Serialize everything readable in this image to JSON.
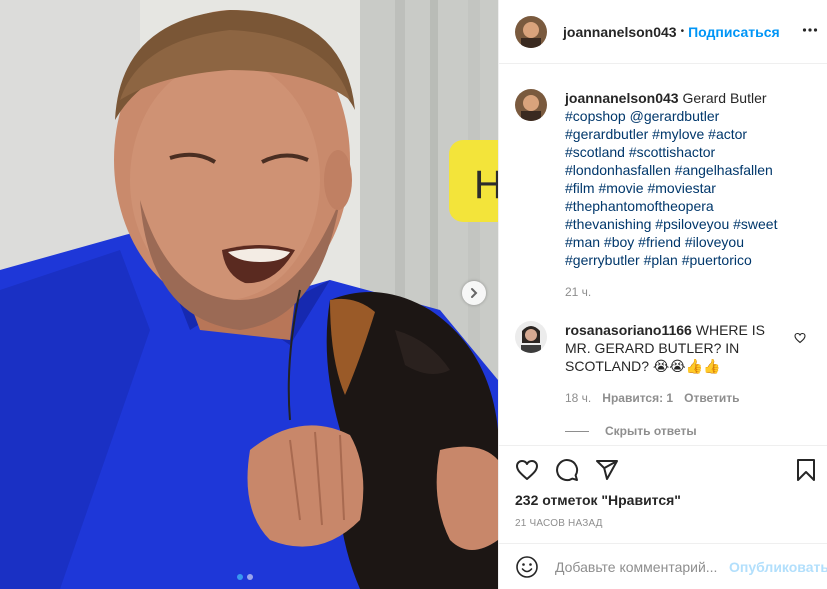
{
  "post": {
    "author": "joannanelson043",
    "header_separator": "•",
    "follow_label": "Подписаться",
    "more_icon": "more-horizontal-icon"
  },
  "media": {
    "next_icon": "chevron-right-icon",
    "slide_index": 1,
    "slide_count": 2,
    "sign_letter": "H"
  },
  "caption": {
    "username": "joannanelson043",
    "text": "Gerard Butler",
    "hashtags": "#copshop @gerardbutler #gerardbutler #mylove #actor #scotland #scottishactor #londonhasfallen #angelhasfallen #film #movie #moviestar #thephantomoftheopera #thevanishing #psiloveyou #sweet #man #boy #friend #iloveyou #gerrybutler #plan #puertorico",
    "time": "21 ч."
  },
  "comment": {
    "username": "rosanasoriano1166",
    "text": "WHERE IS MR. GERARD BUTLER? IN SCOTLAND? 😭😭👍👍",
    "time": "18 ч.",
    "likes": "Нравится: 1",
    "reply": "Ответить",
    "like_icon": "heart-outline-icon"
  },
  "hide_replies": "Скрыть ответы",
  "actions": {
    "like_icon": "heart-outline-icon",
    "comment_icon": "comment-icon",
    "share_icon": "share-icon",
    "save_icon": "bookmark-icon"
  },
  "likes_count": "232 отметок \"Нравится\"",
  "posted_ago": "21 ЧАСОВ НАЗАД",
  "add_comment": {
    "placeholder": "Добавьте комментарий...",
    "publish": "Опубликовать",
    "emoji_icon": "smiley-icon"
  },
  "colors": {
    "link": "#00376b",
    "follow": "#0095f6",
    "publish_disabled": "#b2dffc",
    "muted": "#8e8e8e",
    "shirt": "#1e37d8"
  }
}
